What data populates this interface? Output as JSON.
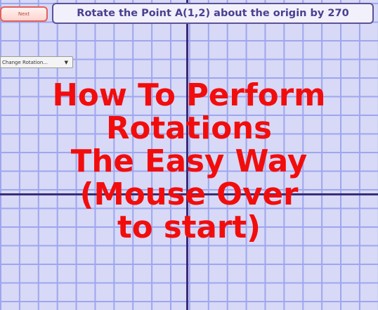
{
  "controls": {
    "next_label": "Next",
    "rotation_select_label": "Change Rotation...",
    "rotation_select_icon": "dropdown-arrow"
  },
  "prompt": {
    "text": "Rotate the Point A(1,2) about the origin by 270"
  },
  "overlay": {
    "lines": [
      "How To Perform",
      "Rotations",
      "The Easy Way",
      "(Mouse Over",
      "to start)"
    ]
  },
  "colors": {
    "background": "#d7d9f6",
    "grid_line": "#9ea6ee",
    "axis": "#3a2d78",
    "title_red": "#f20d0d",
    "prompt_text": "#4a4090"
  }
}
